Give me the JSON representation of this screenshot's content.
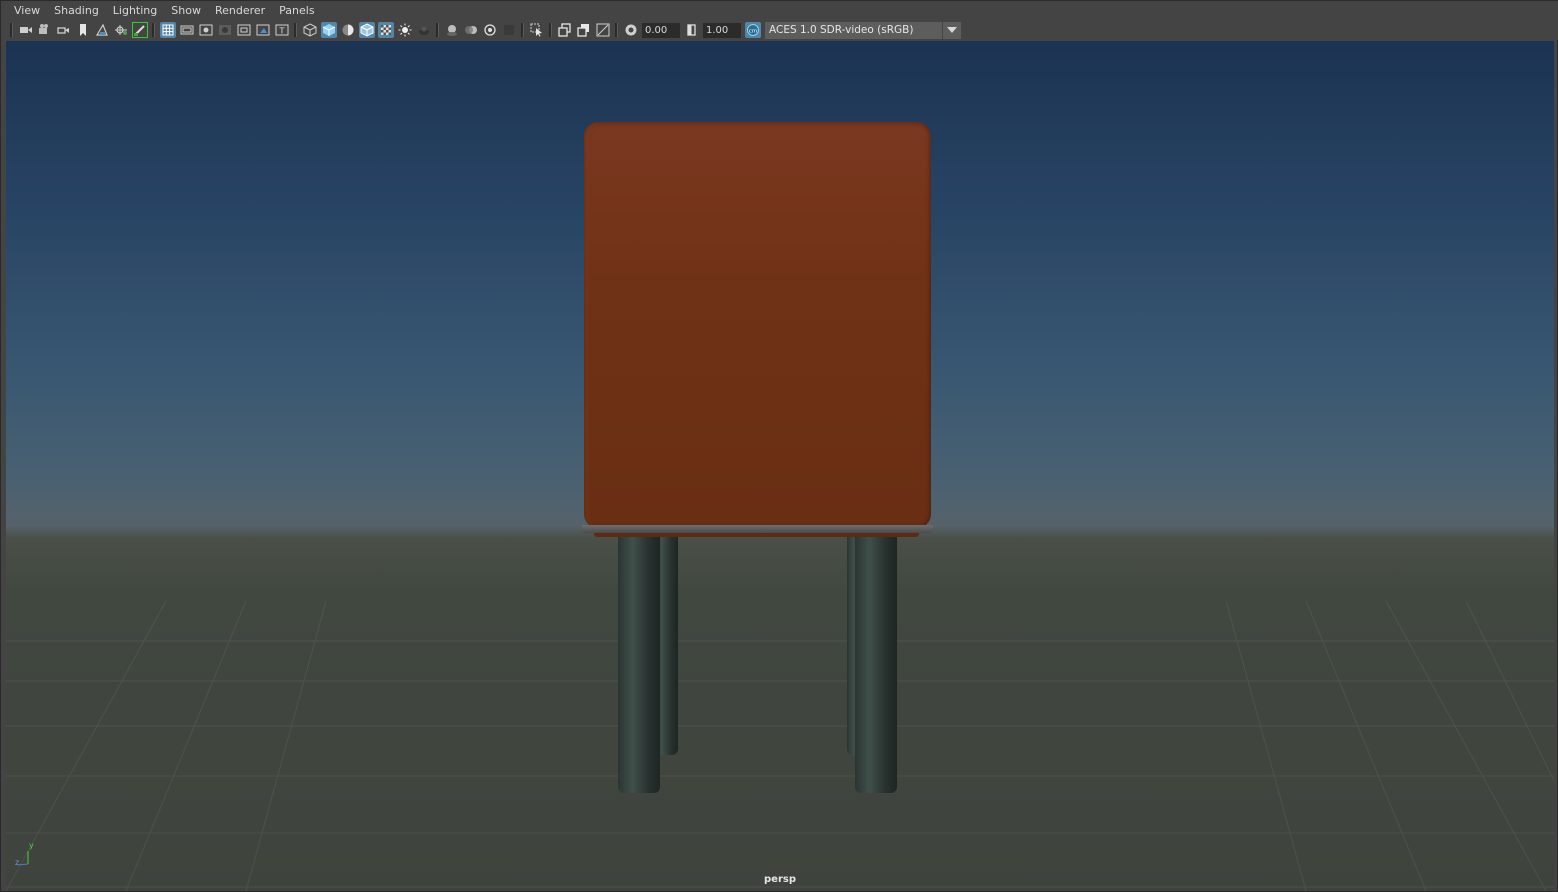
{
  "menu": {
    "items": [
      "View",
      "Shading",
      "Lighting",
      "Show",
      "Renderer",
      "Panels"
    ]
  },
  "toolbar": {
    "icons": [
      "camera-select-icon",
      "camera-attributes-icon",
      "bookmark-icon",
      "image-plane-icon",
      "2d-pan-zoom-icon",
      "grease-pencil-icon",
      "grid-icon",
      "film-gate-icon",
      "resolution-gate-icon",
      "gate-mask-icon",
      "field-chart-icon",
      "safe-action-icon",
      "safe-title-icon",
      "wireframe-icon",
      "smooth-shade-icon",
      "default-material-icon",
      "wireframe-on-shaded-icon",
      "xray-icon",
      "use-all-lights-icon",
      "shadows-icon",
      "screen-space-ao-icon",
      "motion-blur-icon",
      "multisample-aa-icon",
      "depth-of-field-icon",
      "isolate-select-icon",
      "xray-joints-icon",
      "xray-active-components-icon",
      "backface-culling-icon",
      "exposure-icon",
      "gamma-icon",
      "color-management-icon"
    ],
    "exposure_value": "0.00",
    "gamma_value": "1.00",
    "color_space": "ACES 1.0 SDR-video (sRGB)"
  },
  "viewport": {
    "camera_label": "persp",
    "axis": {
      "y": "y",
      "z": "z"
    }
  },
  "colors": {
    "sky_top": "#1c3353",
    "horizon": "#56626a",
    "ground": "#3f433d",
    "cube": "#6e3016",
    "legs": "#2f3a38",
    "active_icon": "#5285a6",
    "active_outline": "#33cc33"
  }
}
